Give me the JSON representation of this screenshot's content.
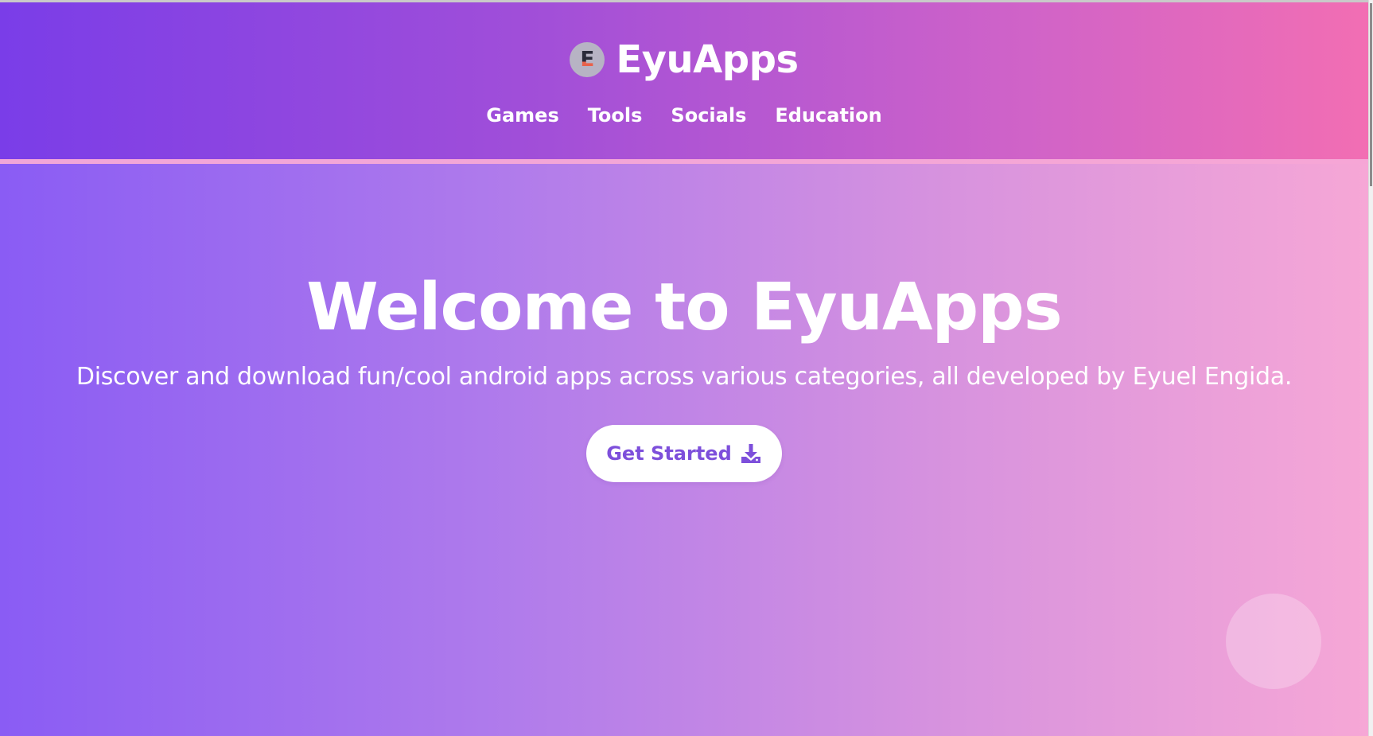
{
  "header": {
    "logo_letter": "E",
    "brand_name": "EyuApps",
    "nav": [
      {
        "label": "Games"
      },
      {
        "label": "Tools"
      },
      {
        "label": "Socials"
      },
      {
        "label": "Education"
      }
    ]
  },
  "hero": {
    "title": "Welcome to EyuApps",
    "subtitle": "Discover and download fun/cool android apps across various categories, all developed by Eyuel Engida.",
    "cta_label": "Get Started",
    "cta_icon": "download-icon"
  },
  "colors": {
    "header_gradient_start": "#7a3de8",
    "header_gradient_end": "#f26eb3",
    "hero_gradient_start": "#8a5cf4",
    "hero_gradient_end": "#f6a7d6",
    "cta_text": "#7d4fdb",
    "text": "#ffffff"
  }
}
